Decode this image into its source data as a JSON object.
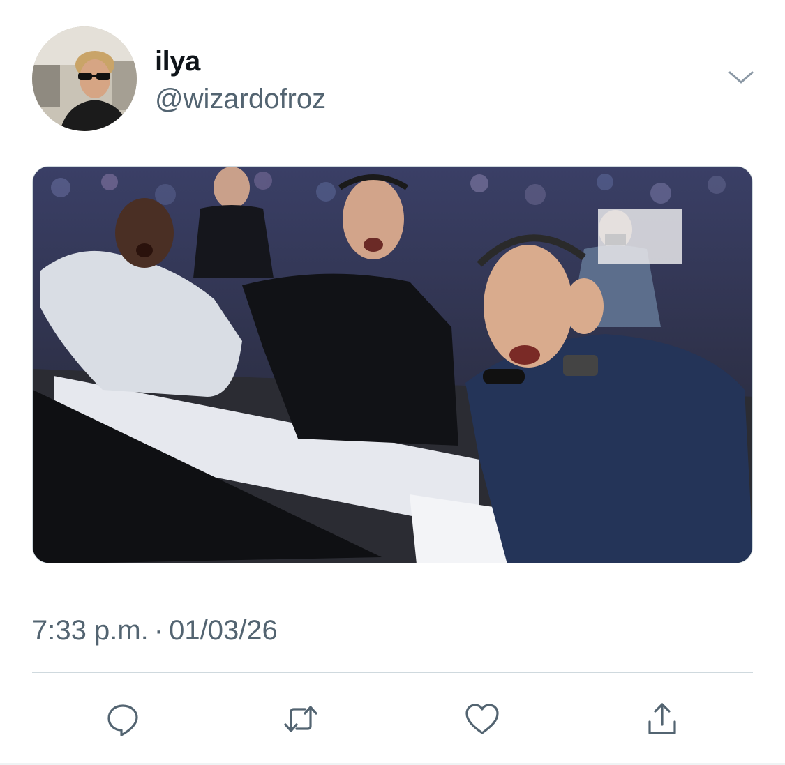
{
  "tweet": {
    "author": {
      "display_name": "ilya",
      "handle": "@wizardofroz",
      "avatar_icon": "profile-photo"
    },
    "menu_icon": "chevron-down-icon",
    "media": {
      "kind": "photo",
      "icon": "photo-commentators-reacting"
    },
    "timestamp": {
      "time": "7:33 p.m.",
      "separator": "·",
      "date": "01/03/26"
    },
    "actions": [
      {
        "icon": "reply-icon"
      },
      {
        "icon": "retweet-icon"
      },
      {
        "icon": "like-icon"
      },
      {
        "icon": "share-icon"
      }
    ]
  },
  "colors": {
    "primary_text": "#0f1419",
    "secondary_text": "#536471",
    "divider": "#cfd9de"
  }
}
